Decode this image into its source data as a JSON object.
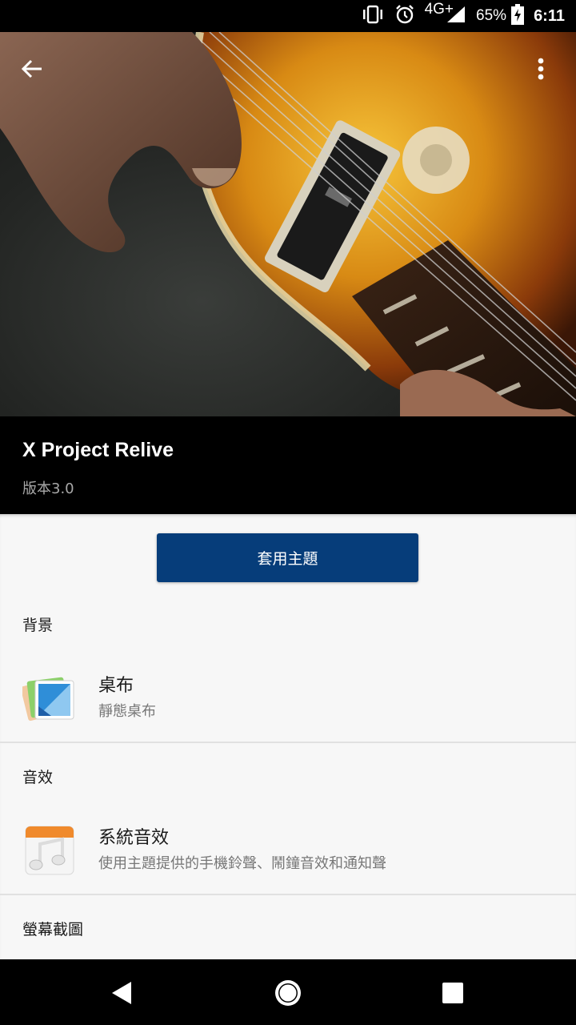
{
  "status_bar": {
    "network": "4G+",
    "battery": "65%",
    "time": "6:11",
    "icons": [
      "vibrate-icon",
      "alarm-icon",
      "signal-icon",
      "battery-charging-icon"
    ]
  },
  "hero": {
    "back_icon": "arrow-back-icon",
    "menu_icon": "more-vert-icon"
  },
  "theme": {
    "title": "X Project Relive",
    "version": "版本3.0"
  },
  "apply_button": "套用主題",
  "sections": {
    "background": {
      "header": "背景",
      "item_title": "桌布",
      "item_subtitle": "靜態桌布",
      "icon": "wallpaper-icon"
    },
    "sound": {
      "header": "音效",
      "item_title": "系統音效",
      "item_subtitle": "使用主題提供的手機鈴聲、鬧鐘音效和通知聲",
      "icon": "music-note-icon"
    },
    "screenshots": {
      "header": "螢幕截圖"
    }
  },
  "navbar": {
    "icons": [
      "nav-back-icon",
      "nav-home-icon",
      "nav-recents-icon"
    ]
  }
}
